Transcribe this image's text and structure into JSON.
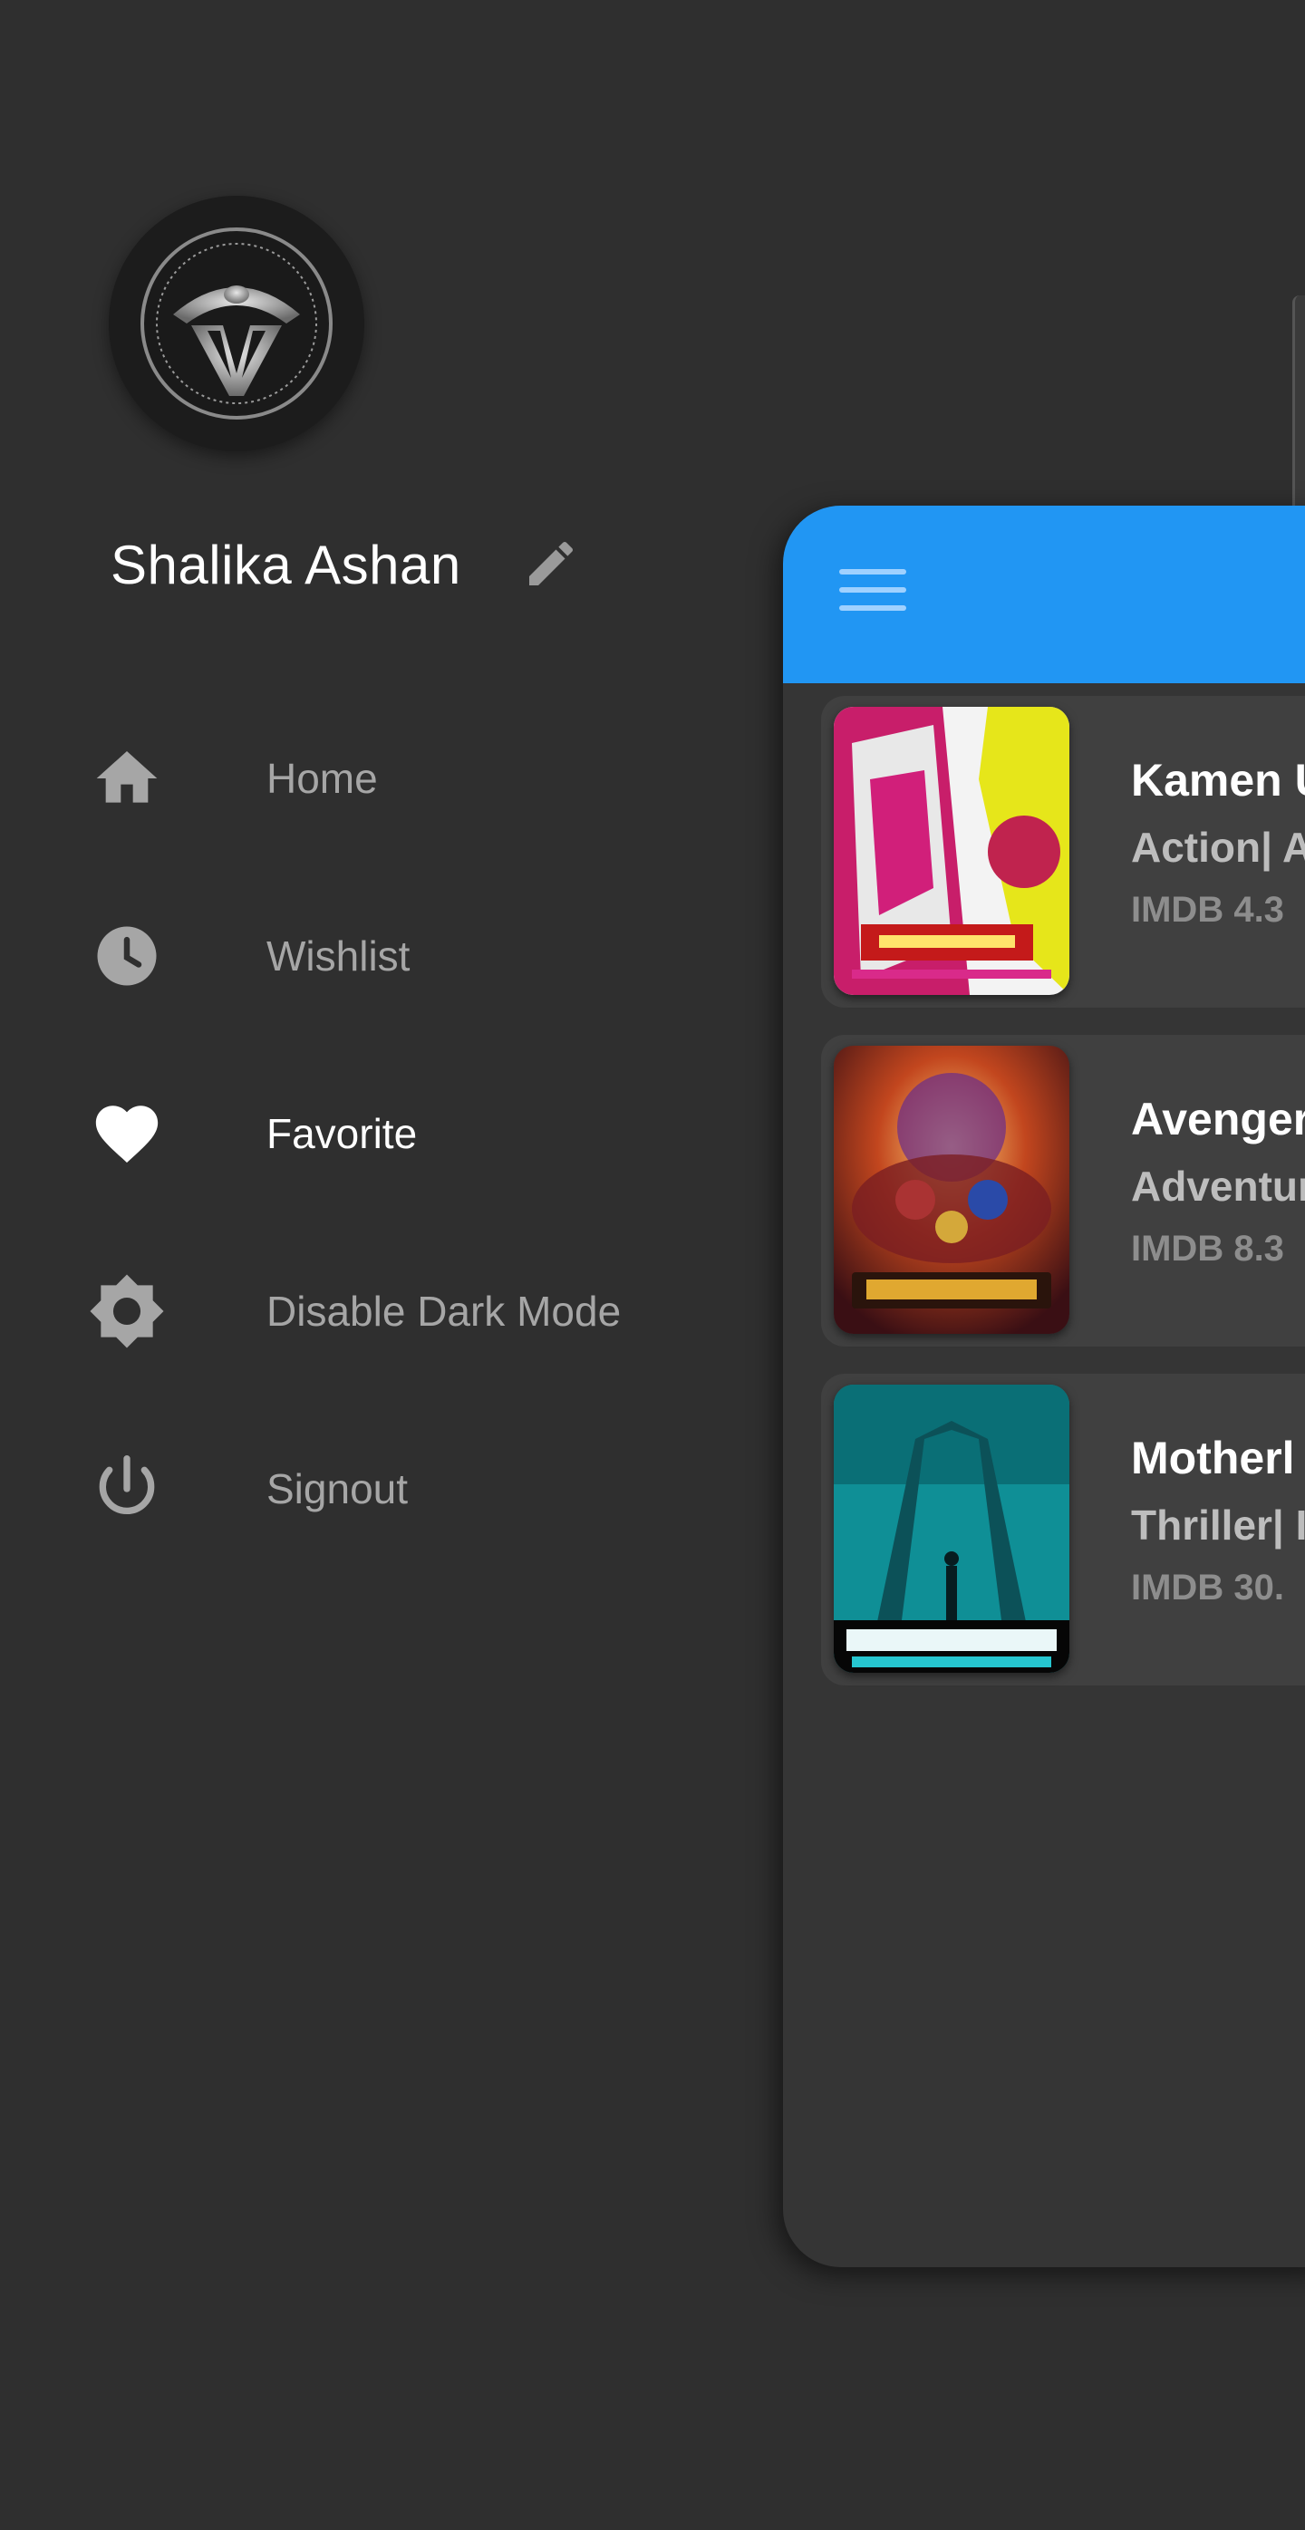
{
  "drawer": {
    "user_name": "Shalika Ashan",
    "menu": [
      {
        "label": "Home",
        "icon": "home-icon"
      },
      {
        "label": "Wishlist",
        "icon": "clock-icon"
      },
      {
        "label": "Favorite",
        "icon": "heart-icon",
        "active": true
      },
      {
        "label": "Disable Dark Mode",
        "icon": "brightness-icon"
      },
      {
        "label": "Signout",
        "icon": "power-icon"
      }
    ]
  },
  "colors": {
    "background": "#2f2f2f",
    "app_bar": "#2196f3",
    "active_text": "#ffffff",
    "inactive_text": "#a6a6a6"
  },
  "movies": [
    {
      "title": "Kamen U",
      "genre": "Action| A",
      "rating": "IMDB 4.3"
    },
    {
      "title": "Avenger",
      "genre": "Adventur",
      "rating": "IMDB 8.3"
    },
    {
      "title": "Motherl",
      "genre": "Thriller| I",
      "rating": "IMDB 30."
    }
  ]
}
